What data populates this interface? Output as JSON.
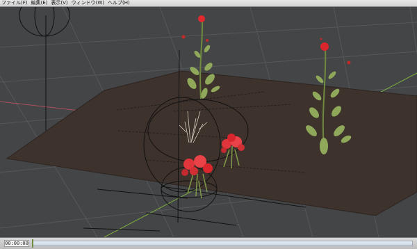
{
  "menu": {
    "items": [
      {
        "label": "ファイル(F)"
      },
      {
        "label": "編集(E)"
      },
      {
        "label": "表示(V)"
      },
      {
        "label": "ウィンドウ(W)"
      },
      {
        "label": "ヘルプ(H)"
      }
    ]
  },
  "timeline": {
    "timecode": "00:00:00",
    "position": 0
  },
  "viewport": {
    "background_color": "#444546",
    "ground_color": "#3e322c",
    "grid_color": "#5a5b5c",
    "x_axis_color": "#b05060",
    "z_axis_color": "#8cc63f",
    "objects": [
      {
        "kind": "plant",
        "flower_color": "#e02a30",
        "leaf_color": "#8fa85a"
      }
    ]
  }
}
